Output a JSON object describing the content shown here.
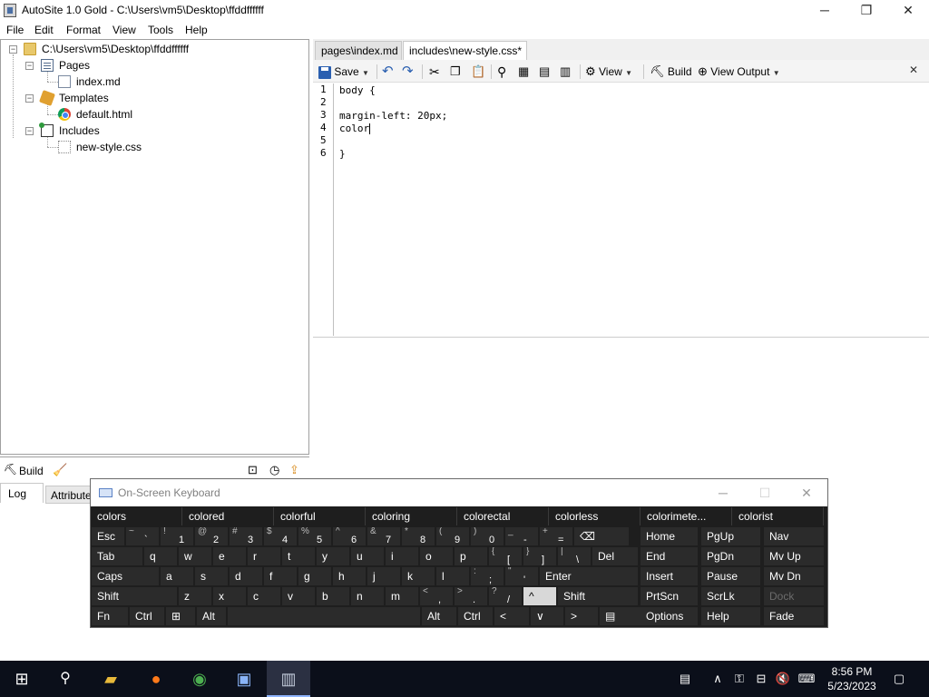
{
  "window": {
    "title": "AutoSite 1.0 Gold - C:\\Users\\vm5\\Desktop\\ffddffffff",
    "minimize": "─",
    "restore": "❐",
    "close": "✕"
  },
  "menu": [
    "File",
    "Edit",
    "Format",
    "View",
    "Tools",
    "Help"
  ],
  "tree": {
    "root": "C:\\Users\\vm5\\Desktop\\ffddffffff",
    "pages": "Pages",
    "index": "index.md",
    "templates": "Templates",
    "default": "default.html",
    "includes": "Includes",
    "css": "new-style.css"
  },
  "tabs": {
    "tab1": "pages\\index.md",
    "tab2": "includes\\new-style.css*"
  },
  "toolbar": {
    "save": "Save",
    "view": "View",
    "build": "Build",
    "view_output": "View Output",
    "close": "✕"
  },
  "code": {
    "lines": [
      "body {",
      "",
      "margin-left: 20px;",
      "color",
      "",
      "}"
    ],
    "numbers": [
      "1",
      "2",
      "3",
      "4",
      "5",
      "6"
    ]
  },
  "build_panel": {
    "build": "Build",
    "log_tab": "Log",
    "attributes_tab": "Attributes"
  },
  "osk": {
    "title": "On-Screen Keyboard",
    "minimize": "─",
    "maximize": "☐",
    "close": "✕",
    "suggestions": [
      "colors",
      "colored",
      "colorful",
      "coloring",
      "colorectal",
      "colorless",
      "colorimete...",
      "colorist"
    ],
    "row1": [
      {
        "alt": "",
        "main": "",
        "label": "Esc"
      },
      {
        "alt": "~",
        "main": "`",
        "label": ""
      },
      {
        "alt": "!",
        "main": "1",
        "label": ""
      },
      {
        "alt": "@",
        "main": "2",
        "label": ""
      },
      {
        "alt": "#",
        "main": "3",
        "label": ""
      },
      {
        "alt": "$",
        "main": "4",
        "label": ""
      },
      {
        "alt": "%",
        "main": "5",
        "label": ""
      },
      {
        "alt": "^",
        "main": "6",
        "label": ""
      },
      {
        "alt": "&",
        "main": "7",
        "label": ""
      },
      {
        "alt": "*",
        "main": "8",
        "label": ""
      },
      {
        "alt": "(",
        "main": "9",
        "label": ""
      },
      {
        "alt": ")",
        "main": "0",
        "label": ""
      },
      {
        "alt": "_",
        "main": "-",
        "label": ""
      },
      {
        "alt": "+",
        "main": "=",
        "label": ""
      },
      {
        "alt": "",
        "main": "",
        "label": "⌫"
      }
    ],
    "row2": [
      "Tab",
      "q",
      "w",
      "e",
      "r",
      "t",
      "y",
      "u",
      "i",
      "o",
      "p",
      "[",
      "]",
      "\\",
      "Del"
    ],
    "row2_alt": [
      "",
      "",
      "",
      "",
      "",
      "",
      "",
      "",
      "",
      "",
      "",
      "{",
      "}",
      "|",
      ""
    ],
    "row3": [
      "Caps",
      "a",
      "s",
      "d",
      "f",
      "g",
      "h",
      "j",
      "k",
      "l",
      ";",
      "'",
      "Enter"
    ],
    "row3_alt": [
      "",
      "",
      "",
      "",
      "",
      "",
      "",
      "",
      "",
      "",
      ":",
      "\"",
      ""
    ],
    "row4": [
      "Shift",
      "z",
      "x",
      "c",
      "v",
      "b",
      "n",
      "m",
      ",",
      ".",
      "/",
      "^",
      "Shift"
    ],
    "row4_alt": [
      "",
      "",
      "",
      "",
      "",
      "",
      "",
      "",
      "<",
      ">",
      "?",
      "",
      ""
    ],
    "row5": [
      "Fn",
      "Ctrl",
      "⊞",
      "Alt",
      "",
      "Alt",
      "Ctrl",
      "<",
      "∨",
      ">",
      "▤"
    ],
    "nav": [
      [
        "Home",
        "PgUp",
        "Nav"
      ],
      [
        "End",
        "PgDn",
        "Mv Up"
      ],
      [
        "Insert",
        "Pause",
        "Mv Dn"
      ],
      [
        "PrtScn",
        "ScrLk",
        "Dock"
      ],
      [
        "Options",
        "Help",
        "Fade"
      ]
    ]
  },
  "taskbar": {
    "time": "8:56 PM",
    "date": "5/23/2023"
  },
  "colors": {
    "accent": "#2a5fb0",
    "osk_bg": "#1e1e1e",
    "taskbar": "#0b0f1a"
  }
}
